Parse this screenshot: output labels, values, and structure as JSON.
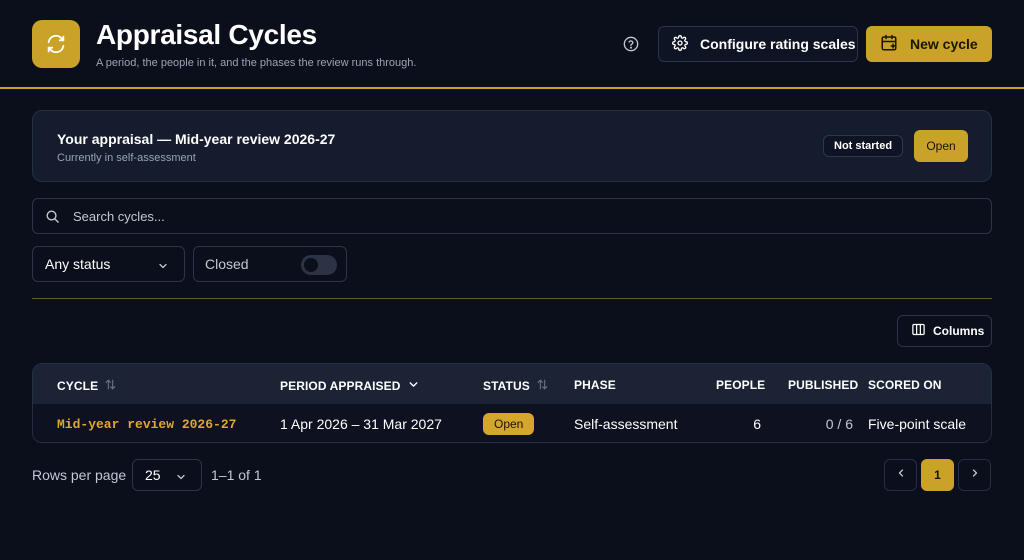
{
  "header": {
    "title": "Appraisal Cycles",
    "subtitle": "A period, the people in it, and the phases the review runs through.",
    "configure_label": "Configure rating scales",
    "new_cycle_label": "New cycle"
  },
  "banner": {
    "title": "Your appraisal — Mid-year review 2026-27",
    "subtitle": "Currently in self-assessment",
    "status_badge": "Not started",
    "open_label": "Open"
  },
  "filters": {
    "search_placeholder": "Search cycles...",
    "status_selected": "Any status",
    "closed_label": "Closed",
    "closed_on": false
  },
  "toolbar": {
    "columns_label": "Columns"
  },
  "table": {
    "headers": {
      "cycle": "CYCLE",
      "period": "PERIOD APPRAISED",
      "status": "STATUS",
      "phase": "PHASE",
      "people": "PEOPLE",
      "published": "PUBLISHED",
      "scored_on": "SCORED ON"
    },
    "rows": [
      {
        "cycle": "Mid-year review 2026-27",
        "period": "1 Apr 2026 – 31 Mar 2027",
        "status": "Open",
        "phase": "Self-assessment",
        "people": "6",
        "published": "0 / 6",
        "scored_on": "Five-point scale"
      }
    ]
  },
  "pagination": {
    "rows_per_page_label": "Rows per page",
    "rows_per_page": "25",
    "range": "1–1 of 1",
    "current_page": "1"
  },
  "colors": {
    "accent": "#c9a227",
    "background": "#0b0f1c",
    "link": "#e0a631"
  }
}
